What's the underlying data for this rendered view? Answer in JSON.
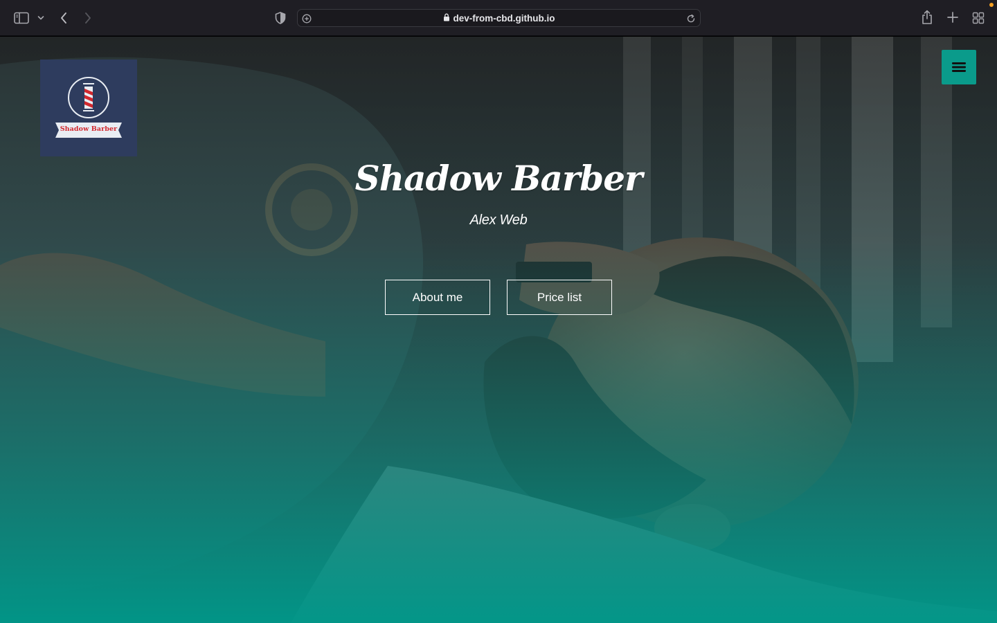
{
  "browser": {
    "url": "dev-from-cbd.github.io"
  },
  "site": {
    "logo_text": "Shadow Barber",
    "title": "Shadow Barber",
    "subtitle": "Alex Web"
  },
  "hero": {
    "buttons": {
      "about": "About me",
      "price": "Price list"
    }
  },
  "colors": {
    "accent": "#0a9b8b",
    "logo_bg": "#2e3c5e",
    "logo_red": "#d2282e",
    "chrome_bg": "#1f1e24"
  },
  "icons": {
    "browser": [
      "sidebar-icon",
      "chevron-down-icon",
      "back-icon",
      "forward-icon",
      "shield-icon",
      "plus-circle-icon",
      "lock-icon",
      "reload-icon",
      "share-icon",
      "plus-icon",
      "tabs-grid-icon"
    ],
    "site": [
      "barber-pole-icon",
      "hamburger-menu-icon"
    ]
  }
}
